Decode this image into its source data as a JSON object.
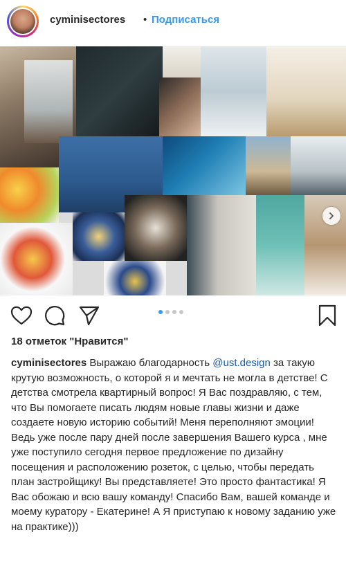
{
  "post": {
    "username": "cyminisectores",
    "separator": "•",
    "follow_label": "Подписаться",
    "likes_text": "18 отметок \"Нравится\"",
    "carousel": {
      "total": 4,
      "active_index": 0
    },
    "caption": {
      "username": "cyminisectores",
      "text_before": " Выражаю благодарность ",
      "mention": "@ust.design",
      "text_after": " за такую крутую возможность, о которой я и мечтать не могла в детстве! С детства смотрела квартирный вопрос! Я Вас поздравляю, с тем, что Вы помогаете писать людям новые главы жизни и даже создаете новую историю событий! Меня переполняют эмоции! Ведь уже после пару дней после завершения Вашего курса , мне уже поступило сегодня первое предложение по дизайну посещения и расположению розеток, с целью, чтобы передать план застройщику! Вы представляете! Это просто фантастика! Я Вас обожаю и всю вашу команду! Спасибо Вам, вашей команде и моему куратору - Екатерине! А Я приступаю к новому заданию уже на практике)))"
    },
    "icons": {
      "like": "heart-icon",
      "comment": "comment-icon",
      "share": "send-icon",
      "save": "bookmark-icon",
      "next": "chevron-right-icon"
    },
    "colors": {
      "link": "#3897f0",
      "mention": "#1a5aa6",
      "text": "#262626"
    }
  }
}
